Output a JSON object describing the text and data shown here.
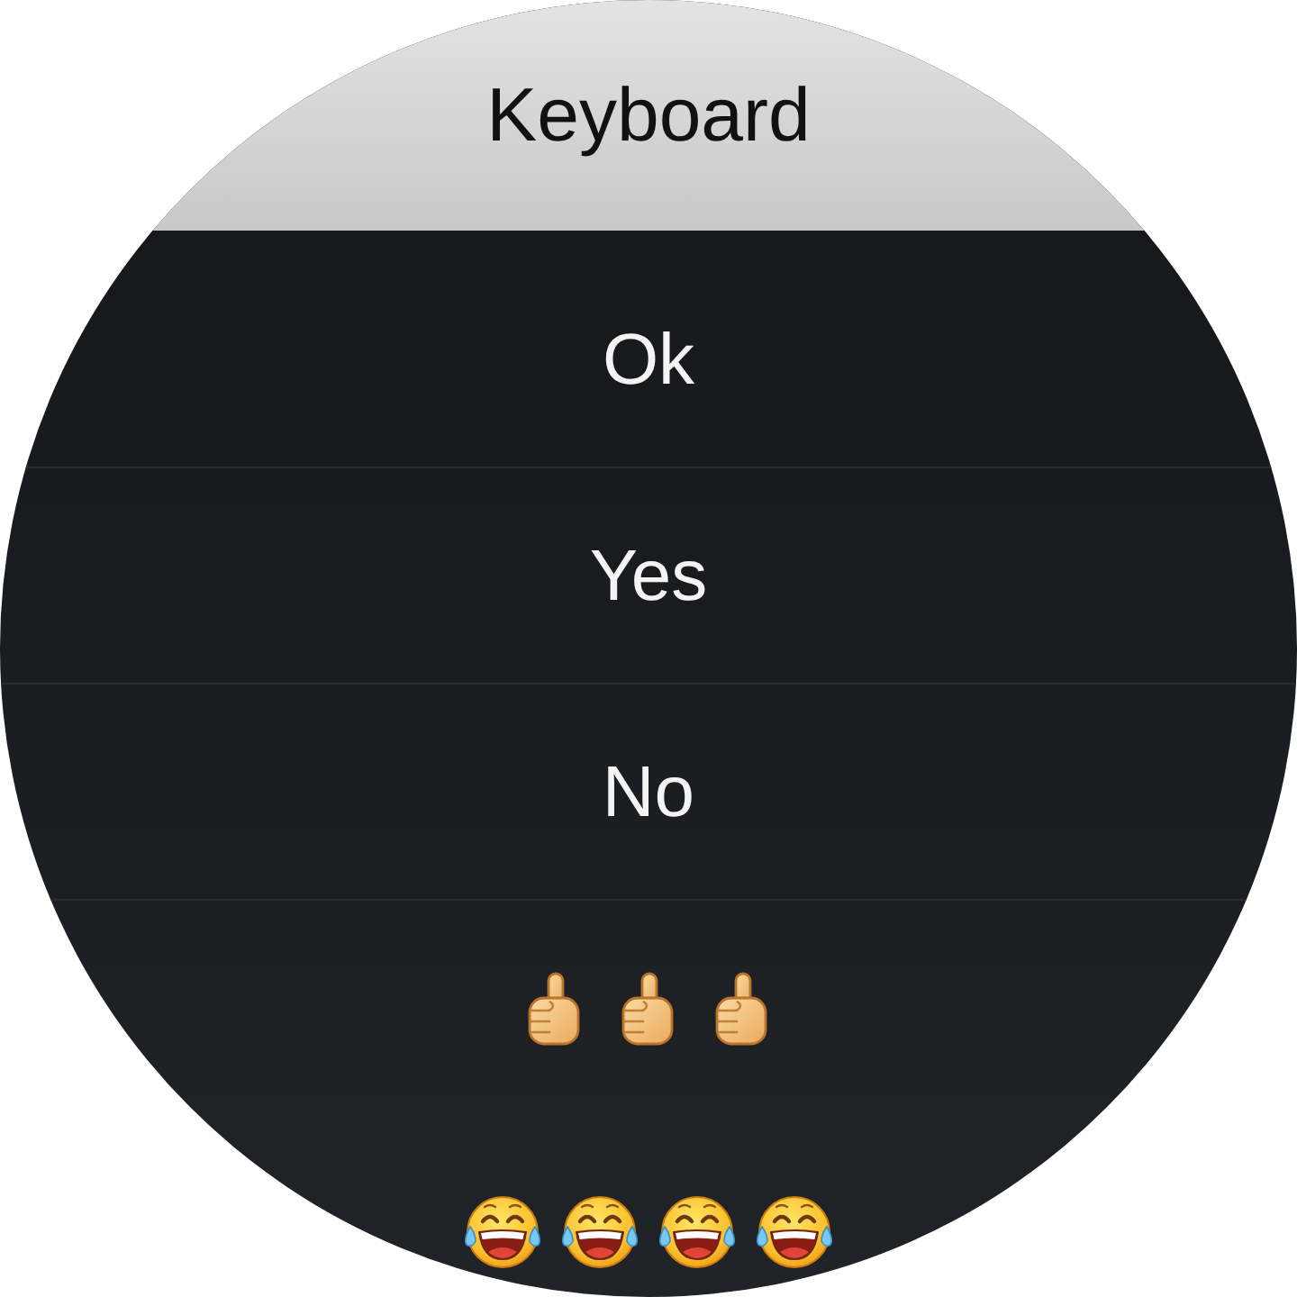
{
  "header": {
    "title": "Keyboard"
  },
  "replies": [
    {
      "kind": "text",
      "text": "Ok"
    },
    {
      "kind": "text",
      "text": "Yes"
    },
    {
      "kind": "text",
      "text": "No"
    },
    {
      "kind": "emoji",
      "emojis": [
        {
          "kind": "thumbs_up"
        },
        {
          "kind": "thumbs_up"
        },
        {
          "kind": "thumbs_up"
        }
      ]
    },
    {
      "kind": "emoji",
      "emojis": [
        {
          "kind": "tears_of_joy"
        },
        {
          "kind": "tears_of_joy"
        },
        {
          "kind": "tears_of_joy"
        },
        {
          "kind": "tears_of_joy"
        }
      ]
    }
  ]
}
